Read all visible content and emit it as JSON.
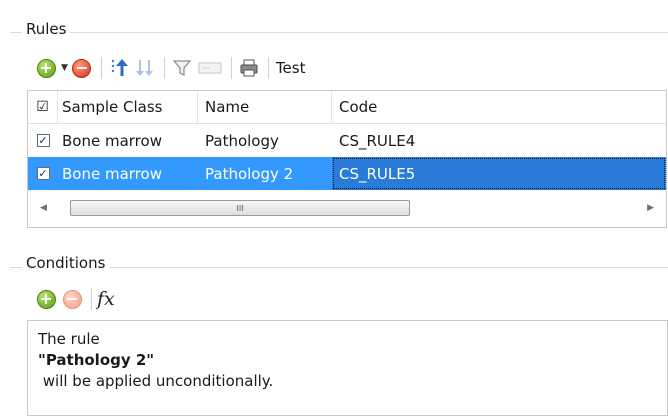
{
  "rules": {
    "title": "Rules",
    "toolbar": {
      "test_label": "Test",
      "icons": [
        "add-icon",
        "dropdown-arrow-icon",
        "remove-icon",
        "move-up-icon",
        "move-down-icon",
        "filter-icon",
        "clear-filter-icon",
        "print-icon"
      ]
    },
    "columns": [
      "Sample Class",
      "Name",
      "Code"
    ],
    "header_check": "☑",
    "rows": [
      {
        "checked": true,
        "sample_class": "Bone marrow",
        "name": "Pathology",
        "code": "CS_RULE4",
        "selected": false
      },
      {
        "checked": true,
        "sample_class": "Bone marrow",
        "name": "Pathology 2",
        "code": "CS_RULE5",
        "selected": true
      }
    ],
    "scroll_thumb_text": "III"
  },
  "conditions": {
    "title": "Conditions",
    "toolbar": {
      "fx_label": "fx"
    },
    "text": {
      "line1": "The rule",
      "rule_name": "\"Pathology 2\"",
      "line3": " will be applied unconditionally."
    }
  },
  "colors": {
    "selection": "#3399ff",
    "add_green": "#5a9a18",
    "remove_red": "#d4361a"
  }
}
